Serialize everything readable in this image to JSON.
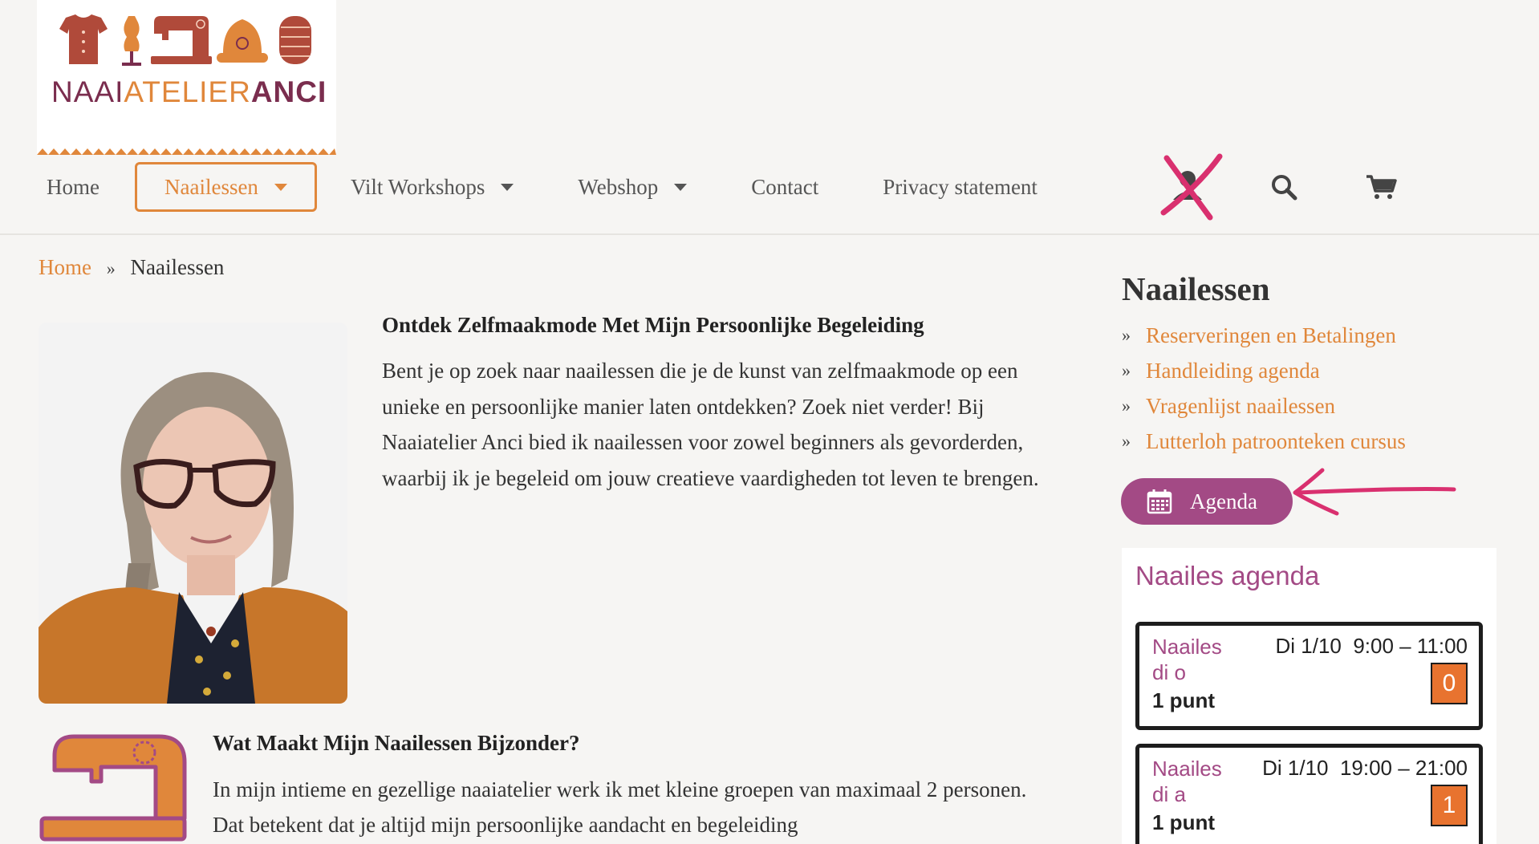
{
  "logo": {
    "text_part1": "NAAI",
    "text_part2": "ATELIER",
    "text_part3": "ANCI",
    "colors": {
      "plum": "#7a2d4e",
      "orange": "#e0873b"
    }
  },
  "nav": {
    "items": [
      {
        "label": "Home",
        "dropdown": false,
        "active": false
      },
      {
        "label": "Naailessen",
        "dropdown": true,
        "active": true
      },
      {
        "label": "Vilt Workshops",
        "dropdown": true,
        "active": false
      },
      {
        "label": "Webshop",
        "dropdown": true,
        "active": false
      },
      {
        "label": "Contact",
        "dropdown": false,
        "active": false
      },
      {
        "label": "Privacy statement",
        "dropdown": false,
        "active": false
      }
    ],
    "icons": [
      "user-icon-crossed-out",
      "search-icon",
      "cart-icon"
    ]
  },
  "breadcrumb": {
    "home": "Home",
    "separator": "»",
    "current": "Naailessen"
  },
  "intro": {
    "heading": "Ontdek Zelfmaakmode Met Mijn Persoonlijke Begeleiding",
    "body": "Bent je op zoek naar naailessen die je de kunst van zelfmaakmode op een unieke en persoonlijke manier laten ontdekken? Zoek niet verder! Bij Naaiatelier Anci bied ik naailessen voor zowel beginners als gevorderden, waarbij ik je begeleid om jouw creatieve vaardigheden tot leven te brengen."
  },
  "special": {
    "heading": "Wat Maakt Mijn Naailessen Bijzonder?",
    "body": "In mijn intieme en gezellige naaiatelier werk ik met kleine groepen van maximaal 2 personen. Dat betekent dat je altijd mijn persoonlijke aandacht en begeleiding"
  },
  "sidebar": {
    "title": "Naailessen",
    "bullet": "»",
    "links": [
      "Reserveringen en Betalingen",
      "Handleiding agenda",
      "Vragenlijst naailessen",
      "Lutterloh patroonteken cursus"
    ],
    "agenda_button": "Agenda",
    "agenda_box": {
      "title": "Naailes agenda",
      "events": [
        {
          "name": "Naailes di o",
          "date": "Di 1/10",
          "time": "9:00 – 11:00",
          "points": "1 punt",
          "count": "0"
        },
        {
          "name": "Naailes di a",
          "date": "Di 1/10",
          "time": "19:00 – 21:00",
          "points": "1 punt",
          "count": "1"
        }
      ]
    }
  },
  "colors": {
    "accent": "#e0873b",
    "plum": "#a34a85",
    "annotation": "#d9306f",
    "background": "#f6f5f3"
  }
}
